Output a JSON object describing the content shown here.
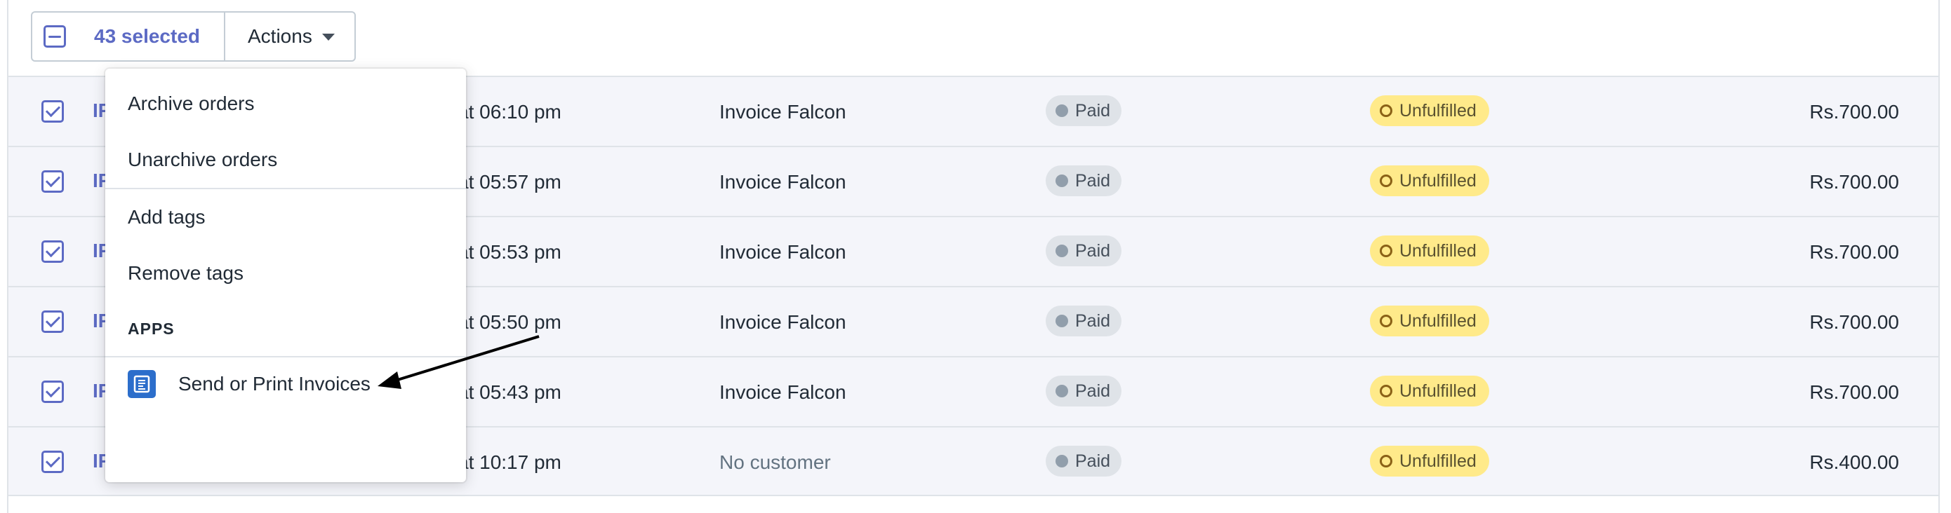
{
  "bulk": {
    "selected_label": "43 selected",
    "actions_label": "Actions"
  },
  "menu": {
    "archive": "Archive orders",
    "unarchive": "Unarchive orders",
    "add_tags": "Add tags",
    "remove_tags": "Remove tags",
    "apps_heading": "APPS",
    "app_item": "Send or Print Invoices"
  },
  "orders": [
    {
      "id": "IF",
      "date": "at 06:10 pm",
      "customer": "Invoice Falcon",
      "payment": "Paid",
      "fulfillment": "Unfulfilled",
      "total": "Rs.700.00"
    },
    {
      "id": "IF",
      "date": "at 05:57 pm",
      "customer": "Invoice Falcon",
      "payment": "Paid",
      "fulfillment": "Unfulfilled",
      "total": "Rs.700.00"
    },
    {
      "id": "IF",
      "date": "at 05:53 pm",
      "customer": "Invoice Falcon",
      "payment": "Paid",
      "fulfillment": "Unfulfilled",
      "total": "Rs.700.00"
    },
    {
      "id": "IF",
      "date": "at 05:50 pm",
      "customer": "Invoice Falcon",
      "payment": "Paid",
      "fulfillment": "Unfulfilled",
      "total": "Rs.700.00"
    },
    {
      "id": "IF",
      "date": "at 05:43 pm",
      "customer": "Invoice Falcon",
      "payment": "Paid",
      "fulfillment": "Unfulfilled",
      "total": "Rs.700.00"
    },
    {
      "id": "IF",
      "date": "at 10:17 pm",
      "customer": "No customer",
      "payment": "Paid",
      "fulfillment": "Unfulfilled",
      "total": "Rs.400.00"
    }
  ],
  "colors": {
    "accent": "#5c6ac4",
    "row_selected_bg": "#f4f5fa",
    "paid_badge": "#dfe3e8",
    "unfulfilled_badge": "#ffea8a",
    "app_icon": "#2c6ecb"
  },
  "icons": {
    "bulk_checkbox": "minus-checkbox-icon",
    "actions_caret": "caret-down-icon",
    "row_checkbox": "checkbox-checked-icon",
    "app": "invoice-app-icon",
    "annotation": "arrow-icon"
  }
}
